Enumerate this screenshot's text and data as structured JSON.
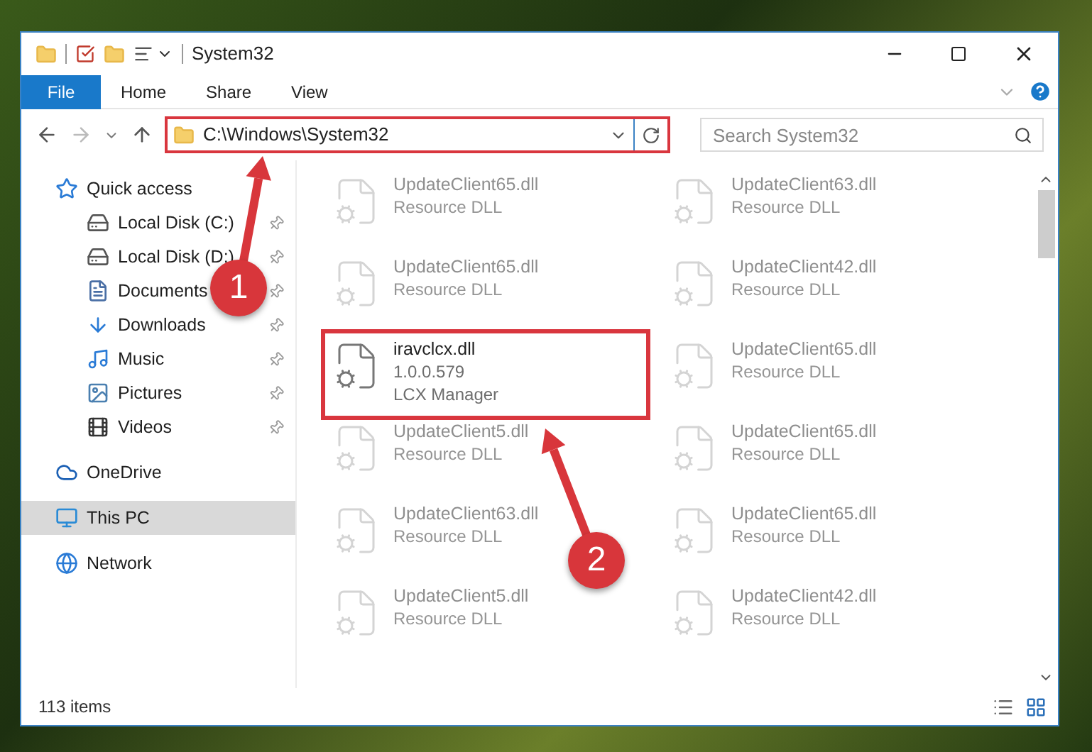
{
  "window": {
    "title": "System32"
  },
  "ribbon_tabs": [
    {
      "label": "File",
      "kind": "file"
    },
    {
      "label": "Home",
      "kind": "tab"
    },
    {
      "label": "Share",
      "kind": "tab"
    },
    {
      "label": "View",
      "kind": "tab"
    }
  ],
  "address": {
    "value": "C:\\Windows\\System32",
    "highlighted": true
  },
  "search": {
    "placeholder": "Search System32"
  },
  "sidebar": {
    "items": [
      {
        "label": "Quick access",
        "selected": false,
        "children": [
          {
            "label": "Local Disk (C:)",
            "pinned": true
          },
          {
            "label": "Local Disk (D:)",
            "pinned": true
          },
          {
            "label": "Documents",
            "pinned": true
          },
          {
            "label": "Downloads",
            "pinned": true
          },
          {
            "label": "Music",
            "pinned": true
          },
          {
            "label": "Pictures",
            "pinned": true
          },
          {
            "label": "Videos",
            "pinned": true
          }
        ]
      },
      {
        "label": "OneDrive",
        "selected": false
      },
      {
        "label": "This PC",
        "selected": true
      },
      {
        "label": "Network",
        "selected": false
      }
    ]
  },
  "files": [
    {
      "name": "UpdateClient65.dll",
      "lines": [
        "Resource DLL"
      ],
      "faded": true,
      "highlighted": false
    },
    {
      "name": "UpdateClient63.dll",
      "lines": [
        "Resource DLL"
      ],
      "faded": true,
      "highlighted": false
    },
    {
      "name": "UpdateClient65.dll",
      "lines": [
        "Resource DLL"
      ],
      "faded": true,
      "highlighted": false
    },
    {
      "name": "UpdateClient42.dll",
      "lines": [
        "Resource DLL"
      ],
      "faded": true,
      "highlighted": false
    },
    {
      "name": "iravclcx.dll",
      "lines": [
        "1.0.0.579",
        "LCX Manager"
      ],
      "faded": false,
      "highlighted": true
    },
    {
      "name": "UpdateClient65.dll",
      "lines": [
        "Resource DLL"
      ],
      "faded": true,
      "highlighted": false
    },
    {
      "name": "UpdateClient5.dll",
      "lines": [
        "Resource DLL"
      ],
      "faded": true,
      "highlighted": false
    },
    {
      "name": "UpdateClient65.dll",
      "lines": [
        "Resource DLL"
      ],
      "faded": true,
      "highlighted": false
    },
    {
      "name": "UpdateClient63.dll",
      "lines": [
        "Resource DLL"
      ],
      "faded": true,
      "highlighted": false
    },
    {
      "name": "UpdateClient65.dll",
      "lines": [
        "Resource DLL"
      ],
      "faded": true,
      "highlighted": false
    },
    {
      "name": "UpdateClient5.dll",
      "lines": [
        "Resource DLL"
      ],
      "faded": true,
      "highlighted": false
    },
    {
      "name": "UpdateClient42.dll",
      "lines": [
        "Resource DLL"
      ],
      "faded": true,
      "highlighted": false
    }
  ],
  "status_bar": {
    "text": "113 items"
  },
  "annotations": [
    {
      "label": "1"
    },
    {
      "label": "2"
    }
  ]
}
